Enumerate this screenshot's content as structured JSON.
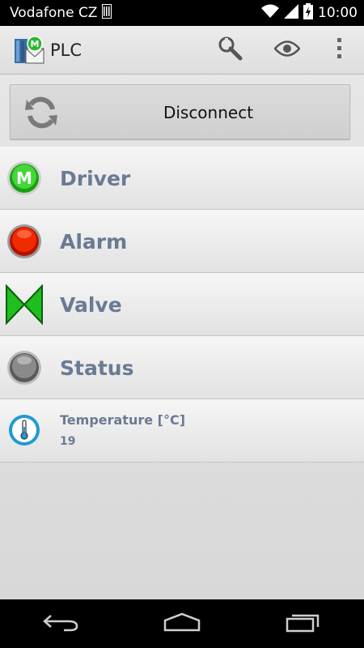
{
  "status_bar": {
    "carrier": "Vodafone CZ",
    "time": "10:00"
  },
  "action_bar": {
    "title": "PLC",
    "icons": [
      "app-logo-icon",
      "wrench-icon",
      "eye-icon",
      "overflow-menu-icon"
    ]
  },
  "connection": {
    "button_label": "Disconnect",
    "icon": "refresh-icon"
  },
  "items": [
    {
      "label": "Driver",
      "icon": "driver-m-icon",
      "color": "#2fbf1f"
    },
    {
      "label": "Alarm",
      "icon": "alarm-led-icon",
      "color": "#e01b00"
    },
    {
      "label": "Valve",
      "icon": "valve-icon",
      "color": "#1fbf1f"
    },
    {
      "label": "Status",
      "icon": "status-led-icon",
      "color": "#808080"
    }
  ],
  "sensor": {
    "title": "Temperature [°C]",
    "value": "19",
    "icon": "thermometer-icon"
  },
  "colors": {
    "label": "#6b7a93",
    "accent_blue": "#1e9ad6"
  }
}
